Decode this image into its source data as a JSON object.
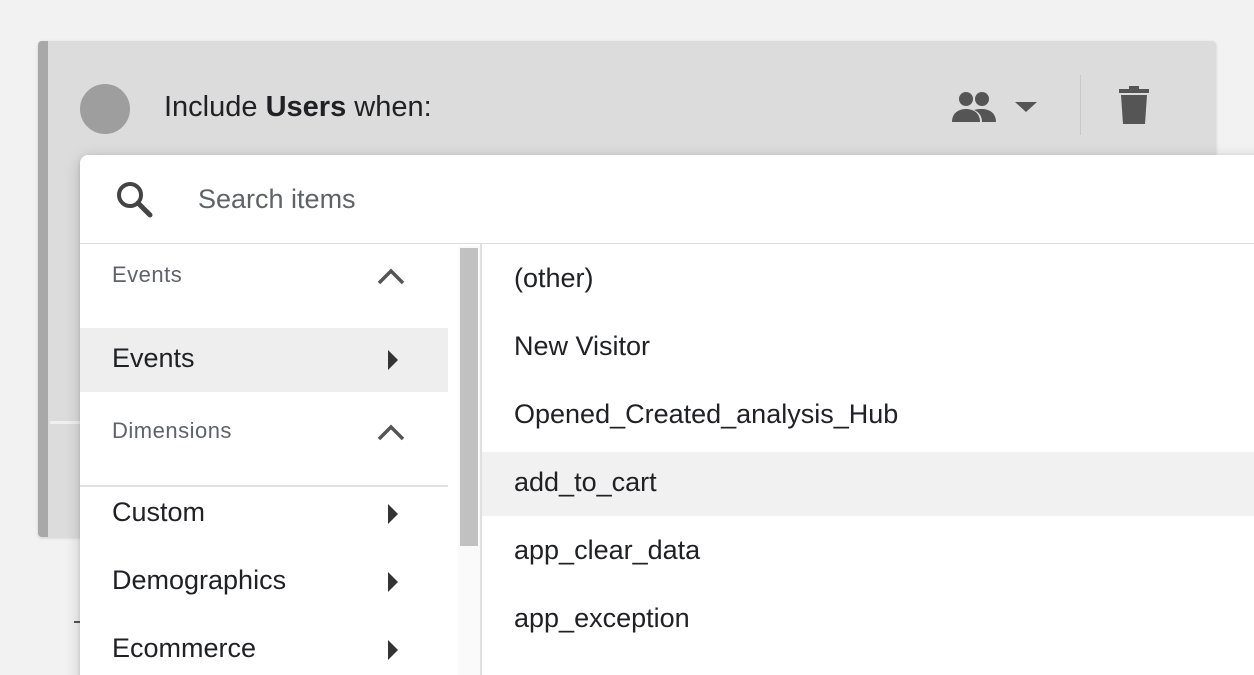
{
  "condition": {
    "title_prefix": "Include",
    "title_scope": "Users",
    "title_suffix": "when:",
    "scope_icon": "people-icon",
    "delete_icon": "trash-icon"
  },
  "search": {
    "placeholder": "Search items",
    "value": ""
  },
  "categories": {
    "events_section": "Events",
    "events_items": [
      {
        "label": "Events",
        "active": true
      }
    ],
    "dimensions_section": "Dimensions",
    "dimension_items": [
      {
        "label": "Custom"
      },
      {
        "label": "Demographics"
      },
      {
        "label": "Ecommerce"
      }
    ]
  },
  "values": [
    {
      "label": "(other)"
    },
    {
      "label": "New Visitor"
    },
    {
      "label": "Opened_Created_analysis_Hub"
    },
    {
      "label": "add_to_cart",
      "hover": true
    },
    {
      "label": "app_clear_data"
    },
    {
      "label": "app_exception"
    }
  ],
  "colors": {
    "text_primary": "#202124",
    "text_secondary": "#5f6368",
    "icon": "#555555",
    "active_bg": "#eeeeee",
    "hover_bg": "#f1f1f1"
  }
}
